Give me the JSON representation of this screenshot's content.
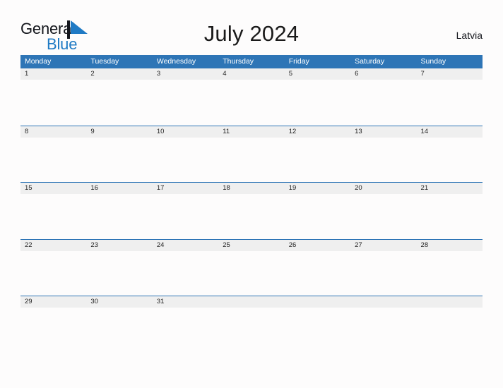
{
  "brand": {
    "name_part1": "General",
    "name_part2": "Blue",
    "flag_icon": "blue-triangle-flag-icon",
    "color_dark": "#14161c",
    "color_blue": "#1f7ac4"
  },
  "header": {
    "title": "July 2024",
    "country": "Latvia"
  },
  "theme": {
    "header_blue": "#2e75b6",
    "row_line_blue": "#2e75b6",
    "date_band_gray": "#efefef",
    "page_background": "#fdfcfc",
    "date_text": "#232323"
  },
  "calendar": {
    "weekdays": [
      "Monday",
      "Tuesday",
      "Wednesday",
      "Thursday",
      "Friday",
      "Saturday",
      "Sunday"
    ],
    "weeks": [
      [
        "1",
        "2",
        "3",
        "4",
        "5",
        "6",
        "7"
      ],
      [
        "8",
        "9",
        "10",
        "11",
        "12",
        "13",
        "14"
      ],
      [
        "15",
        "16",
        "17",
        "18",
        "19",
        "20",
        "21"
      ],
      [
        "22",
        "23",
        "24",
        "25",
        "26",
        "27",
        "28"
      ],
      [
        "29",
        "30",
        "31",
        "",
        "",
        "",
        ""
      ]
    ]
  }
}
